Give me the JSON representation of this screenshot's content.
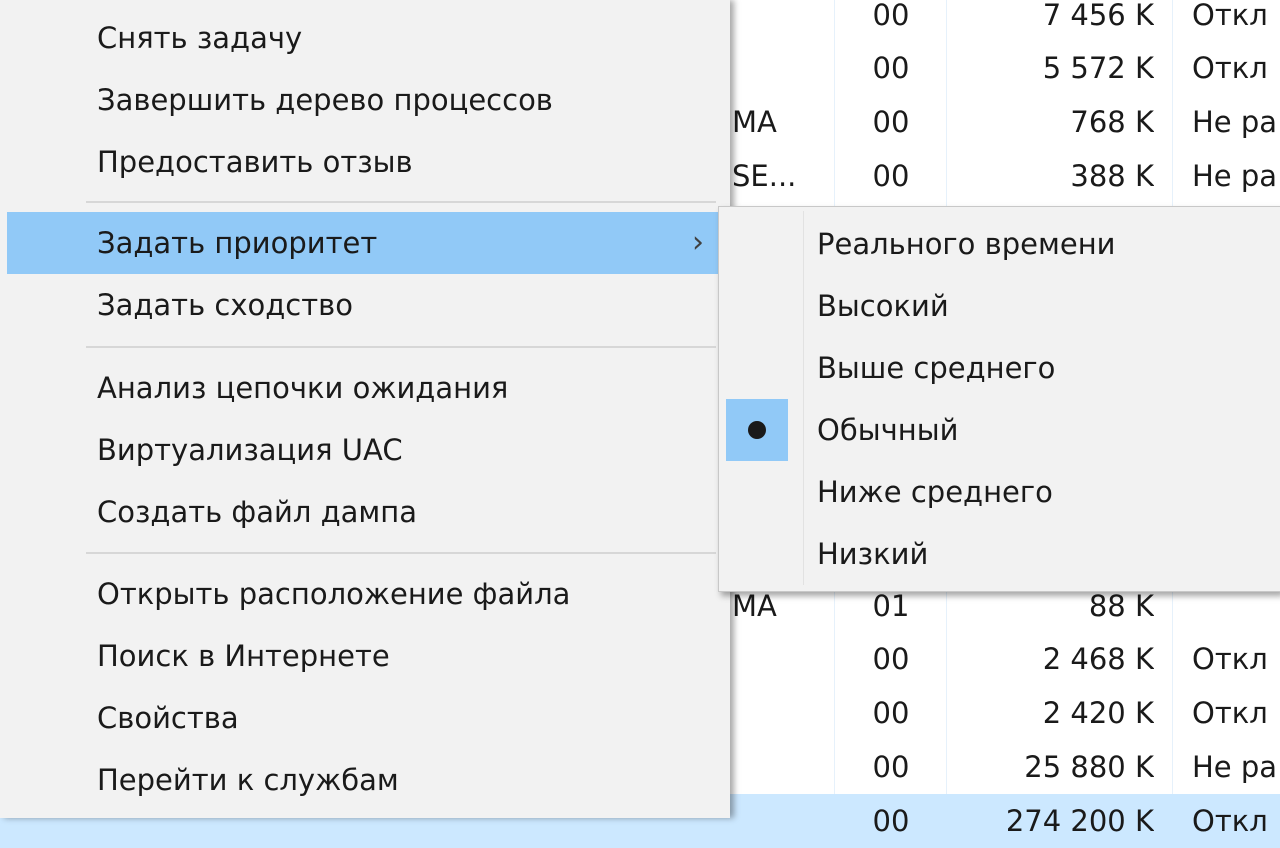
{
  "process_table": {
    "rows": [
      {
        "user": "",
        "cpu": "00",
        "mem": "7 456 K",
        "virt": "Откл"
      },
      {
        "user": "",
        "cpu": "00",
        "mem": "5 572 K",
        "virt": "Откл"
      },
      {
        "user": "MA",
        "cpu": "00",
        "mem": "768 K",
        "virt": "Не ра"
      },
      {
        "user": "SE...",
        "cpu": "00",
        "mem": "388 K",
        "virt": "Не ра"
      },
      {
        "user": "MA",
        "cpu": "01",
        "mem": "88 K",
        "virt": ""
      },
      {
        "user": "",
        "cpu": "00",
        "mem": "2 468 K",
        "virt": "Откл"
      },
      {
        "user": "",
        "cpu": "00",
        "mem": "2 420 K",
        "virt": "Откл"
      },
      {
        "user": "",
        "cpu": "00",
        "mem": "25 880 K",
        "virt": "Не ра"
      },
      {
        "user": "",
        "cpu": "00",
        "mem": "274 200 K",
        "virt": "Откл"
      }
    ]
  },
  "context_menu": {
    "items": [
      {
        "label": "Снять задачу"
      },
      {
        "label": "Завершить дерево процессов"
      },
      {
        "label": "Предоставить отзыв"
      },
      {
        "label": "Задать приоритет"
      },
      {
        "label": "Задать сходство"
      },
      {
        "label": "Анализ цепочки ожидания"
      },
      {
        "label": "Виртуализация UAC"
      },
      {
        "label": "Создать файл дампа"
      },
      {
        "label": "Открыть расположение файла"
      },
      {
        "label": "Поиск в Интернете"
      },
      {
        "label": "Свойства"
      },
      {
        "label": "Перейти к службам"
      }
    ],
    "highlighted": "Задать приоритет",
    "submenu_arrow": "›"
  },
  "priority_submenu": {
    "items": [
      {
        "label": "Реального времени"
      },
      {
        "label": "Высокий"
      },
      {
        "label": "Выше среднего"
      },
      {
        "label": "Обычный"
      },
      {
        "label": "Ниже среднего"
      },
      {
        "label": "Низкий"
      }
    ],
    "selected": "Обычный"
  },
  "colors": {
    "menu_background": "#f2f2f2",
    "highlight": "#91c9f7",
    "selected_row": "#cce8ff"
  }
}
